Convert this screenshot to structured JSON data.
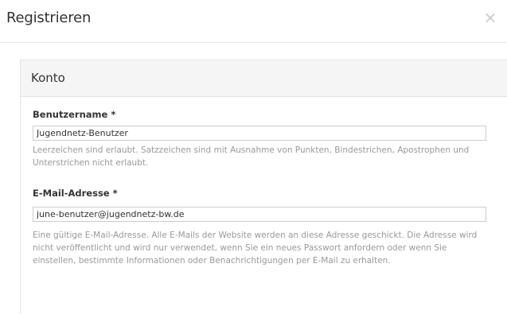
{
  "modal": {
    "title": "Registrieren",
    "close_glyph": "×"
  },
  "fieldset": {
    "legend": "Konto",
    "username": {
      "label": "Benutzername",
      "required_mark": "*",
      "value": "Jugendnetz-Benutzer",
      "description": "Leerzeichen sind erlaubt. Satzzeichen sind mit Ausnahme von Punkten, Bindestrichen, Apostrophen und Unterstrichen nicht erlaubt."
    },
    "email": {
      "label": "E-Mail-Adresse",
      "required_mark": "*",
      "value": "june-benutzer@jugendnetz-bw.de",
      "description": "Eine gültige E-Mail-Adresse. Alle E-Mails der Website werden an diese Adresse geschickt. Die Adresse wird nicht veröffentlicht und wird nur verwendet, wenn Sie ein neues Passwort anfordern oder wenn Sie einstellen, bestimmte Informationen oder Benachrichtigungen per E-Mail zu erhalten."
    }
  }
}
